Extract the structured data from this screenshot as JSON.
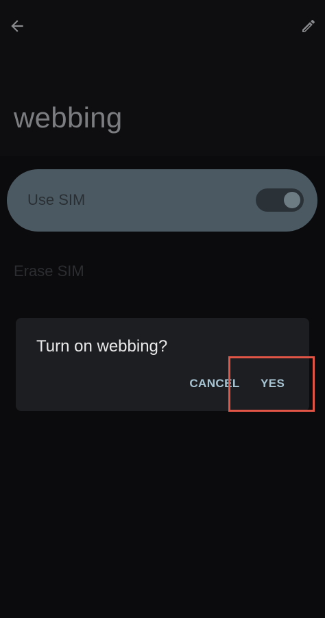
{
  "header": {
    "back_icon": "arrow-left-icon",
    "edit_icon": "pencil-icon",
    "title": "webbing"
  },
  "settings": {
    "use_sim_label": "Use SIM",
    "use_sim_enabled": true,
    "erase_sim_label": "Erase SIM"
  },
  "dialog": {
    "title": "Turn on webbing?",
    "cancel_label": "CANCEL",
    "yes_label": "YES"
  },
  "colors": {
    "card_bg": "#4b5a62",
    "dialog_bg": "#1d1e21",
    "accent_text": "#a7c4d3",
    "highlight": "#e05546"
  }
}
